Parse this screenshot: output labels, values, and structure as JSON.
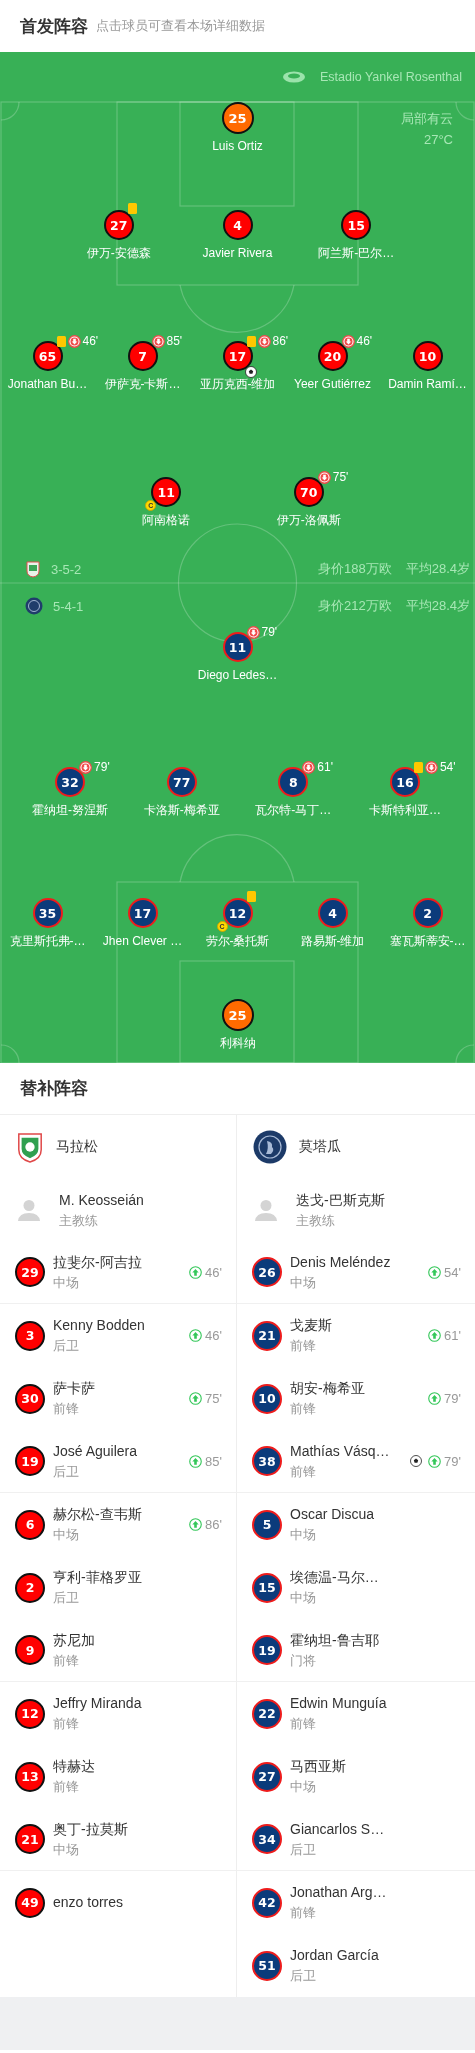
{
  "header": {
    "title": "首发阵容",
    "subtitle": "点击球员可查看本场详细数据"
  },
  "pitch": {
    "stadium": "Estadio Yankel Rosenthal",
    "weather": "局部有云",
    "temperature": "27°C",
    "teams": [
      {
        "kind": "home",
        "formation": "3-5-2",
        "value": "身价188万欧",
        "avg_age": "平均28.4岁",
        "lines": [
          {
            "players": [
              {
                "number": "25",
                "name": "Luis Ortiz",
                "kind": "goalkeeper",
                "yellow_card": false,
                "captain": false,
                "goal": false
              }
            ]
          },
          {
            "players": [
              {
                "number": "27",
                "name": "伊万-安德森",
                "kind": "outfield",
                "yellow_card": true,
                "captain": false,
                "goal": false
              },
              {
                "number": "4",
                "name": "Javier Rivera",
                "kind": "outfield",
                "yellow_card": false,
                "captain": false,
                "goal": false
              },
              {
                "number": "15",
                "name": "阿兰斯-巴尔…",
                "kind": "outfield",
                "yellow_card": false,
                "captain": false,
                "goal": false
              }
            ]
          },
          {
            "players": [
              {
                "number": "65",
                "name": "Jonathan Bu…",
                "kind": "outfield",
                "yellow_card": true,
                "captain": false,
                "goal": false,
                "sub_off": "46'"
              },
              {
                "number": "7",
                "name": "伊萨克-卡斯…",
                "kind": "outfield",
                "yellow_card": false,
                "captain": false,
                "goal": false,
                "sub_off": "85'"
              },
              {
                "number": "17",
                "name": "亚历克西-维加",
                "kind": "outfield",
                "yellow_card": true,
                "captain": false,
                "goal": true,
                "sub_off": "86'"
              },
              {
                "number": "20",
                "name": "Yeer Gutiérrez",
                "kind": "outfield",
                "yellow_card": false,
                "captain": false,
                "goal": false,
                "sub_off": "46'"
              },
              {
                "number": "10",
                "name": "Damin Ramí…",
                "kind": "outfield",
                "yellow_card": false,
                "captain": false,
                "goal": false
              }
            ]
          },
          {
            "players": [
              {
                "number": "11",
                "name": "阿南格诺",
                "kind": "outfield",
                "yellow_card": false,
                "captain": true,
                "captain_mark": "C",
                "goal": false
              },
              {
                "number": "70",
                "name": "伊万-洛佩斯",
                "kind": "outfield",
                "yellow_card": false,
                "captain": false,
                "goal": false,
                "sub_off": "75'"
              }
            ]
          }
        ]
      },
      {
        "kind": "away",
        "formation": "5-4-1",
        "value": "身价212万欧",
        "avg_age": "平均28.4岁",
        "lines": [
          {
            "players": [
              {
                "number": "11",
                "name": "Diego Ledes…",
                "kind": "outfield",
                "yellow_card": false,
                "captain": false,
                "goal": false,
                "sub_off": "79'"
              }
            ]
          },
          {
            "players": [
              {
                "number": "32",
                "name": "霍纳坦-努涅斯",
                "kind": "outfield",
                "yellow_card": false,
                "captain": false,
                "goal": false,
                "sub_off": "79'"
              },
              {
                "number": "77",
                "name": "卡洛斯-梅希亚",
                "kind": "outfield",
                "yellow_card": false,
                "captain": false,
                "goal": false
              },
              {
                "number": "8",
                "name": "瓦尔特-马丁…",
                "kind": "outfield",
                "yellow_card": false,
                "captain": false,
                "goal": false,
                "sub_off": "61'"
              },
              {
                "number": "16",
                "name": "卡斯特利亚…",
                "kind": "outfield",
                "yellow_card": true,
                "captain": false,
                "goal": false,
                "sub_off": "54'"
              }
            ]
          },
          {
            "players": [
              {
                "number": "35",
                "name": "克里斯托弗-…",
                "kind": "outfield",
                "yellow_card": false,
                "captain": false,
                "goal": false
              },
              {
                "number": "17",
                "name": "Jhen Clever …",
                "kind": "outfield",
                "yellow_card": false,
                "captain": false,
                "goal": false
              },
              {
                "number": "12",
                "name": "劳尔-桑托斯",
                "kind": "outfield",
                "yellow_card": true,
                "captain": true,
                "captain_mark": "C",
                "goal": false
              },
              {
                "number": "4",
                "name": "路易斯-维加",
                "kind": "outfield",
                "yellow_card": false,
                "captain": false,
                "goal": false
              },
              {
                "number": "2",
                "name": "塞瓦斯蒂安-…",
                "kind": "outfield",
                "yellow_card": false,
                "captain": false,
                "goal": false
              }
            ]
          },
          {
            "players": [
              {
                "number": "25",
                "name": "利科纳",
                "kind": "goalkeeper",
                "yellow_card": false,
                "captain": false,
                "goal": false
              }
            ]
          }
        ]
      }
    ]
  },
  "substitutes": {
    "title": "替补阵容",
    "teams": [
      {
        "kind": "home",
        "name": "马拉松",
        "coach": "M. Keosseián",
        "coach_role": "主教练",
        "players": [
          {
            "number": "29",
            "name": "拉斐尔-阿吉拉",
            "position": "中场",
            "sub_on": "46'",
            "goal": false
          },
          {
            "number": "3",
            "name": "Kenny Bodden",
            "position": "后卫",
            "sub_on": "46'",
            "goal": false
          },
          {
            "number": "30",
            "name": "萨卡萨",
            "position": "前锋",
            "sub_on": "75'",
            "goal": false
          },
          {
            "number": "19",
            "name": "José Aguilera",
            "position": "后卫",
            "sub_on": "85'",
            "goal": false
          },
          {
            "number": "6",
            "name": "赫尔松-查韦斯",
            "position": "中场",
            "sub_on": "86'",
            "goal": false
          },
          {
            "number": "2",
            "name": "亨利-菲格罗亚",
            "position": "后卫",
            "goal": false
          },
          {
            "number": "9",
            "name": "苏尼加",
            "position": "前锋",
            "goal": false
          },
          {
            "number": "12",
            "name": "Jeffry Miranda",
            "position": "前锋",
            "goal": false
          },
          {
            "number": "13",
            "name": "特赫达",
            "position": "前锋",
            "goal": false
          },
          {
            "number": "21",
            "name": "奥丁-拉莫斯",
            "position": "中场",
            "goal": false
          },
          {
            "number": "49",
            "name": "enzo torres",
            "goal": false
          }
        ]
      },
      {
        "kind": "away",
        "name": "莫塔瓜",
        "coach": "迭戈-巴斯克斯",
        "coach_role": "主教练",
        "players": [
          {
            "number": "26",
            "name": "Denis Meléndez",
            "position": "中场",
            "sub_on": "54'",
            "goal": false
          },
          {
            "number": "21",
            "name": "戈麦斯",
            "position": "前锋",
            "sub_on": "61'",
            "goal": false
          },
          {
            "number": "10",
            "name": "胡安-梅希亚",
            "position": "前锋",
            "sub_on": "79'",
            "goal": false
          },
          {
            "number": "38",
            "name": "Mathías Vásq…",
            "position": "前锋",
            "sub_on": "79'",
            "goal": true
          },
          {
            "number": "5",
            "name": "Oscar Discua",
            "position": "中场",
            "goal": false
          },
          {
            "number": "15",
            "name": "埃德温-马尔…",
            "position": "中场",
            "goal": false
          },
          {
            "number": "19",
            "name": "霍纳坦-鲁吉耶",
            "position": "门将",
            "goal": false
          },
          {
            "number": "22",
            "name": "Edwin Munguía",
            "position": "前锋",
            "goal": false
          },
          {
            "number": "27",
            "name": "马西亚斯",
            "position": "中场",
            "goal": false
          },
          {
            "number": "34",
            "name": "Giancarlos S…",
            "position": "后卫",
            "goal": false
          },
          {
            "number": "42",
            "name": "Jonathan Arg…",
            "position": "前锋",
            "goal": false
          },
          {
            "number": "51",
            "name": "Jordan García",
            "position": "后卫",
            "goal": false
          }
        ]
      }
    ]
  }
}
